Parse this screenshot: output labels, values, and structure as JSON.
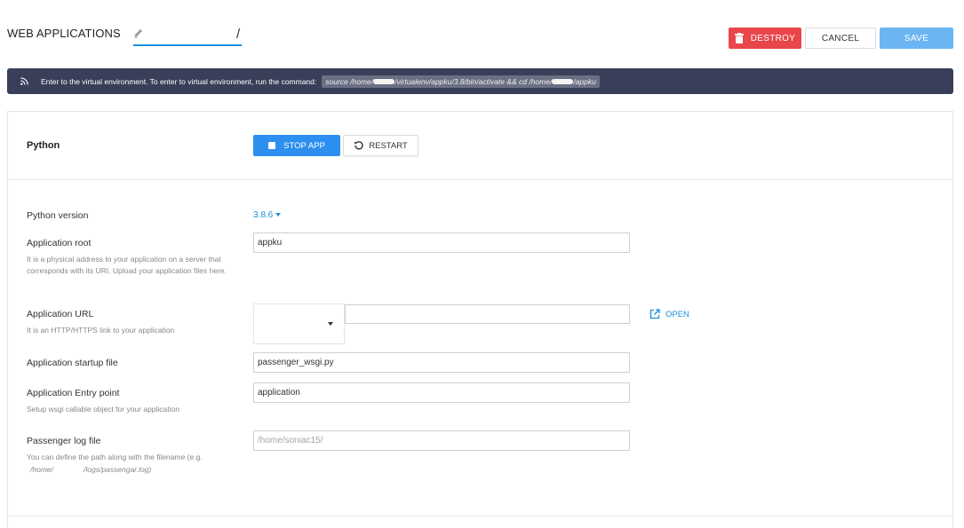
{
  "header": {
    "title": "WEB APPLICATIONS",
    "path_separator": "/",
    "destroy_label": "DESTROY",
    "cancel_label": "CANCEL",
    "save_label": "SAVE"
  },
  "banner": {
    "message": "Enter to the virtual environment. To enter to virtual environment, run the command:",
    "command_part1": "source /home/",
    "command_part2": "/virtualenv/appku/3.8/bin/activate && cd /home/",
    "command_part3": "/appku"
  },
  "app": {
    "section_title": "Python",
    "stop_label": "STOP APP",
    "restart_label": "RESTART"
  },
  "form": {
    "python_version_label": "Python version",
    "python_version_value": "3.8.6",
    "app_root_label": "Application root",
    "app_root_help": "It is a physical address to your application on a server that corresponds with its URI. Upload your application files here.",
    "app_root_value": "appku",
    "app_url_label": "Application URL",
    "app_url_help": "It is an HTTP/HTTPS link to your application",
    "app_url_value": "",
    "open_label": "OPEN",
    "startup_label": "Application startup file",
    "startup_value": "passenger_wsgi.py",
    "entry_label": "Application Entry point",
    "entry_help": "Setup wsgi callable object for your application",
    "entry_value": "application",
    "log_label": "Passenger log file",
    "log_help": "You can define the path along with the filename (e.g.",
    "log_help_path1": "/home/",
    "log_help_path2": "/logs/passengar.log)",
    "log_placeholder": "/home/soniac15/"
  },
  "colors": {
    "accent": "#1b8fe0",
    "destroy": "#e8464a",
    "save": "#6bb6f2",
    "banner_bg": "#3a3f59"
  }
}
